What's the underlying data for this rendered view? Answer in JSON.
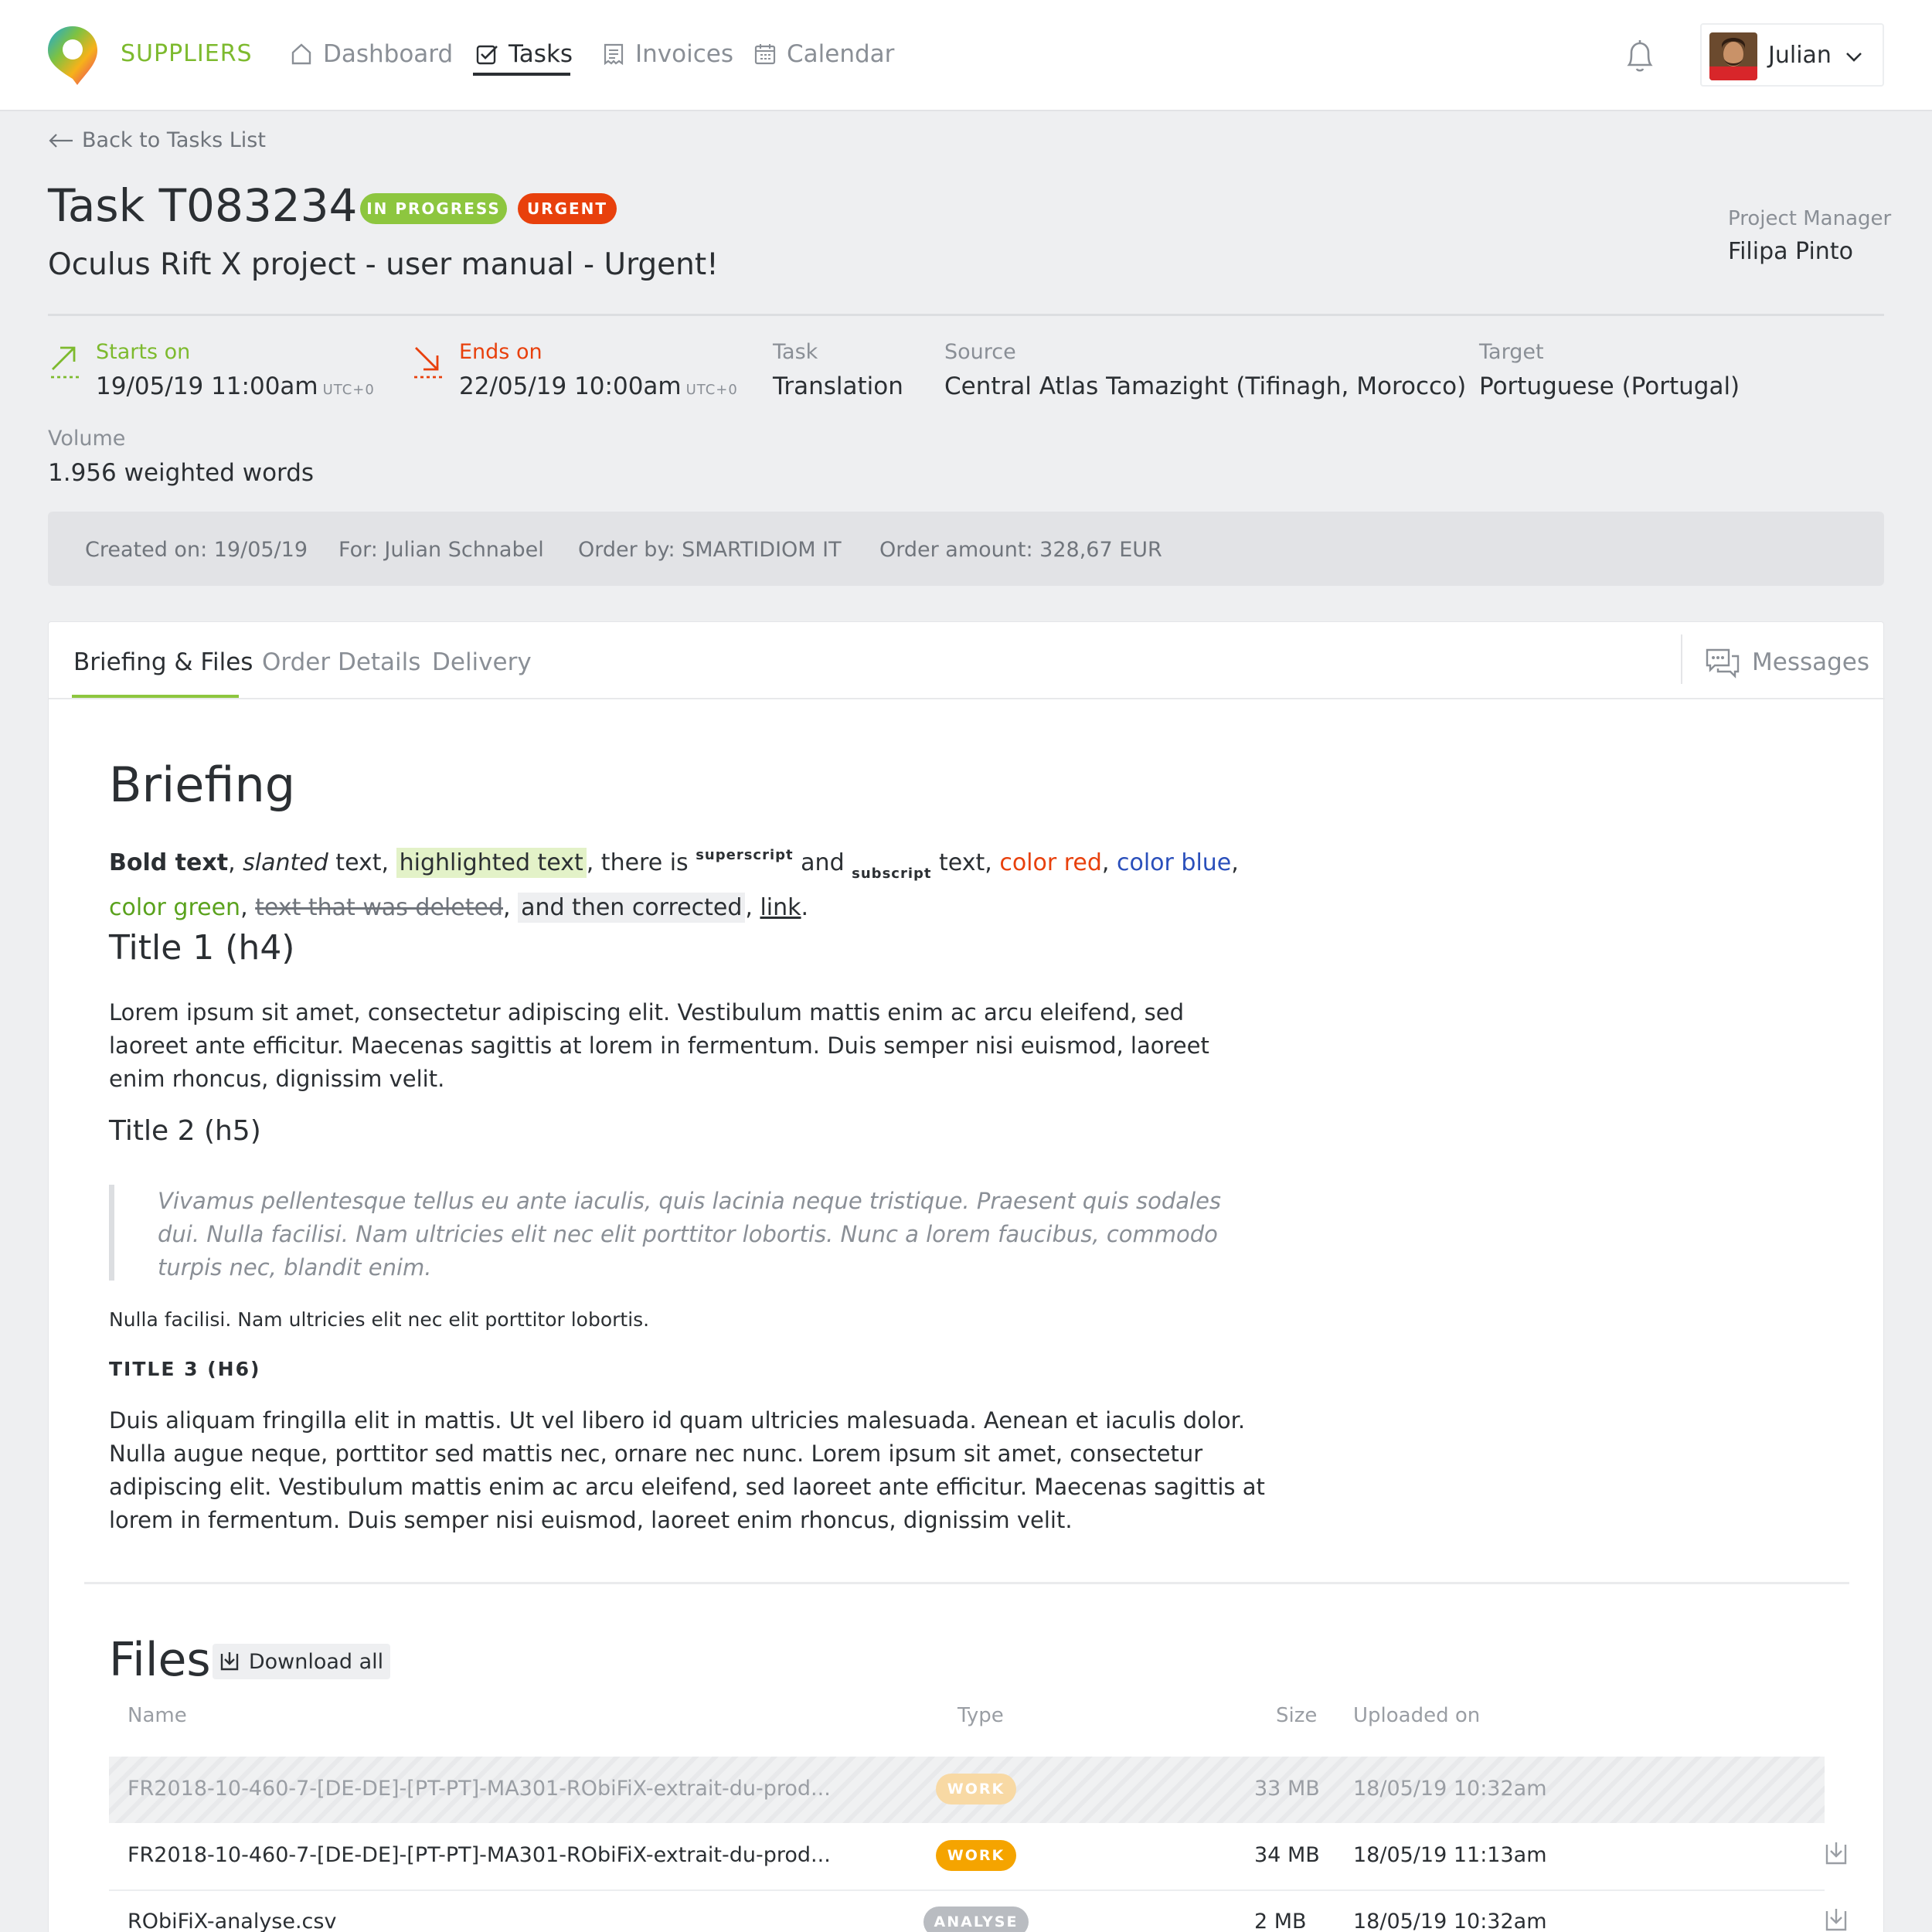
{
  "brand": {
    "name": "SUPPLIERS"
  },
  "nav": [
    {
      "label": "Dashboard",
      "icon": "home-icon"
    },
    {
      "label": "Tasks",
      "icon": "checkbox-icon",
      "active": true
    },
    {
      "label": "Invoices",
      "icon": "receipt-icon"
    },
    {
      "label": "Calendar",
      "icon": "calendar-icon"
    }
  ],
  "user": {
    "name": "Julian"
  },
  "back_link": "Back to Tasks List",
  "task": {
    "title": "Task T083234",
    "status_badge": "IN PROGRESS",
    "priority_badge": "URGENT",
    "subtitle": "Oculus Rift X project - user manual - Urgent!",
    "project_manager_label": "Project Manager",
    "project_manager": "Filipa Pinto"
  },
  "meta": {
    "starts_label": "Starts on",
    "starts_value": "19/05/19 11:00am",
    "starts_tz": "UTC+0",
    "ends_label": "Ends on",
    "ends_value": "22/05/19 10:00am",
    "ends_tz": "UTC+0",
    "task_label": "Task",
    "task_value": "Translation",
    "source_label": "Source",
    "source_value": "Central Atlas Tamazight (Tifinagh, Morocco)",
    "target_label": "Target",
    "target_value": "Portuguese (Portugal)",
    "volume_label": "Volume",
    "volume_value": "1.956 weighted words"
  },
  "order_bar": {
    "created": "Created on: 19/05/19",
    "for": "For: Julian Schnabel",
    "order_by": "Order by: SMARTIDIOM IT",
    "amount": "Order amount: 328,67 EUR"
  },
  "tabs": [
    {
      "label": "Briefing & Files",
      "active": true
    },
    {
      "label": "Order Details"
    },
    {
      "label": "Delivery"
    }
  ],
  "messages_label": "Messages",
  "briefing": {
    "heading": "Briefing",
    "rich": {
      "bold": "Bold text",
      "sep1": ", ",
      "slanted": "slanted",
      "after_slanted": " text, ",
      "highlighted": "highlighted text",
      "after_highlighted": ", there is ",
      "superscript": "superscript",
      "and": " and ",
      "subscript": "subscript",
      "after_subscript": " text, ",
      "red": "color red",
      "comma1": ", ",
      "blue": "color blue",
      "comma2": ", ",
      "green": "color green",
      "comma3": ", ",
      "deleted": "text that was deleted",
      "comma4": ", ",
      "corrected": "and then corrected",
      "comma5": ", ",
      "link": "link",
      "end": "."
    },
    "h4": "Title 1 (h4)",
    "p1": "Lorem ipsum sit amet, consectetur adipiscing elit. Vestibulum mattis enim ac arcu eleifend, sed laoreet ante efficitur. Maecenas sagittis at lorem in fermentum. Duis semper nisi euismod, laoreet enim rhoncus, dignissim velit.",
    "h5": "Title 2 (h5)",
    "quote": "Vivamus pellentesque tellus eu ante iaculis, quis lacinia neque tristique. Praesent quis sodales dui. Nulla facilisi. Nam ultricies elit nec elit porttitor lobortis. Nunc a lorem faucibus, commodo turpis nec, blandit enim.",
    "small": "Nulla facilisi. Nam ultricies elit nec elit porttitor lobortis.",
    "h6": "TITLE 3 (H6)",
    "p2": "Duis aliquam fringilla elit in mattis. Ut vel libero id quam ultricies malesuada. Aenean et iaculis dolor. Nulla augue neque, porttitor sed mattis nec, ornare nec nunc. Lorem ipsum sit amet, consectetur adipiscing elit. Vestibulum mattis enim ac arcu eleifend, sed laoreet ante efficitur. Maecenas sagittis at lorem in fermentum. Duis semper nisi euismod, laoreet enim rhoncus, dignissim velit."
  },
  "files": {
    "heading": "Files",
    "download_all": "Download all",
    "columns": {
      "name": "Name",
      "type": "Type",
      "size": "Size",
      "uploaded": "Uploaded on"
    },
    "rows": [
      {
        "name": "FR2018-10-460-7-[DE-DE]-[PT-PT]-MA301-RObiFiX-extrait-du-prod...",
        "type": "WORK",
        "size": "33 MB",
        "uploaded": "18/05/19 10:32am"
      },
      {
        "name": "FR2018-10-460-7-[DE-DE]-[PT-PT]-MA301-RObiFiX-extrait-du-prod...",
        "type": "WORK",
        "size": "34 MB",
        "uploaded": "18/05/19 11:13am"
      },
      {
        "name": "RObiFiX-analyse.csv",
        "type": "ANALYSE",
        "size": "2 MB",
        "uploaded": "18/05/19 10:32am"
      }
    ]
  },
  "colors": {
    "accent_green": "#8dc63f",
    "urgent_red": "#e8400c",
    "work_orange": "#f5a400",
    "text_blue": "#2a4fbb"
  }
}
